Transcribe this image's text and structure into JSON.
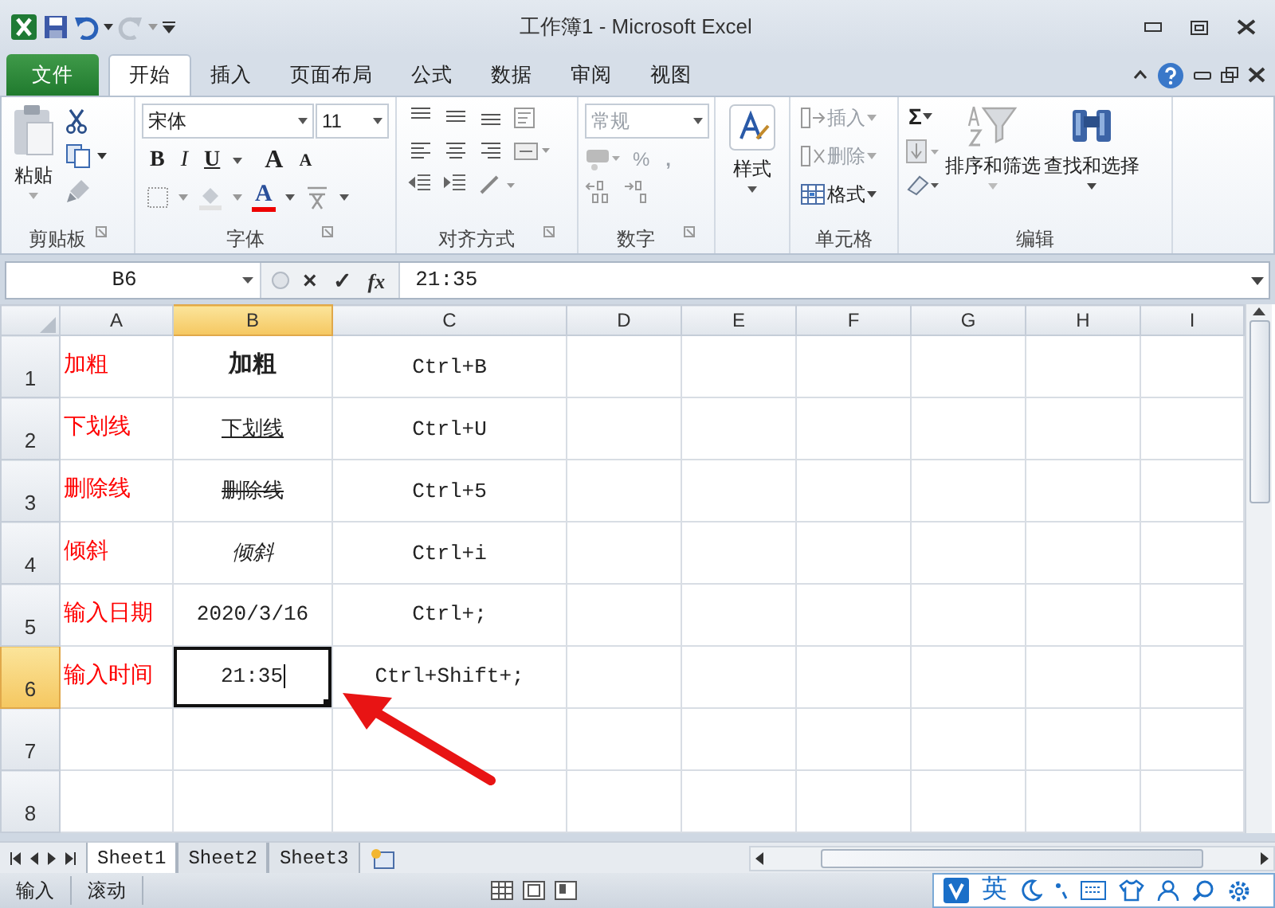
{
  "window": {
    "title": "工作簿1 - Microsoft Excel"
  },
  "tabs": [
    {
      "label": "文件",
      "kind": "file",
      "selected": false
    },
    {
      "label": "开始",
      "kind": "tab",
      "selected": true
    },
    {
      "label": "插入",
      "kind": "tab",
      "selected": false
    },
    {
      "label": "页面布局",
      "kind": "tab",
      "selected": false
    },
    {
      "label": "公式",
      "kind": "tab",
      "selected": false
    },
    {
      "label": "数据",
      "kind": "tab",
      "selected": false
    },
    {
      "label": "审阅",
      "kind": "tab",
      "selected": false
    },
    {
      "label": "视图",
      "kind": "tab",
      "selected": false
    }
  ],
  "ribbon": {
    "clipboard": {
      "label": "剪贴板",
      "paste": "粘贴"
    },
    "font": {
      "label": "字体",
      "font_name": "宋体",
      "font_size": "11",
      "bold": "B",
      "italic": "I",
      "underline": "U",
      "grow": "A",
      "shrink": "A",
      "font_color_button": "A"
    },
    "alignment": {
      "label": "对齐方式"
    },
    "number": {
      "label": "数字",
      "format": "常规",
      "percent": "%",
      "comma": ","
    },
    "styles": {
      "button": "样式"
    },
    "cells": {
      "label": "单元格",
      "buttons": [
        {
          "label": "插入",
          "disabled": true
        },
        {
          "label": "删除",
          "disabled": true
        },
        {
          "label": "格式",
          "disabled": false
        }
      ]
    },
    "editing": {
      "label": "编辑",
      "sum": "Σ",
      "buttons": [
        {
          "label": "排序和筛选",
          "disabled": true
        },
        {
          "label": "查找和选择",
          "disabled": false
        }
      ]
    }
  },
  "formula_bar": {
    "name_box": "B6",
    "cancel": "×",
    "enter": "✓",
    "fx": "fx",
    "value": "21:35"
  },
  "columns": [
    {
      "label": "A",
      "selected": false
    },
    {
      "label": "B",
      "selected": true
    },
    {
      "label": "C",
      "selected": false
    },
    {
      "label": "D",
      "selected": false
    },
    {
      "label": "E",
      "selected": false
    },
    {
      "label": "F",
      "selected": false
    },
    {
      "label": "G",
      "selected": false
    },
    {
      "label": "H",
      "selected": false
    },
    {
      "label": "I",
      "selected": false
    }
  ],
  "rows": [
    {
      "header": "1",
      "selected": false,
      "cells": [
        {
          "text": "加粗",
          "kind": "plain",
          "selected": false
        },
        {
          "text": "加粗",
          "kind": "bold",
          "selected": false
        },
        {
          "text": "Ctrl+B",
          "kind": "plain",
          "selected": false
        }
      ]
    },
    {
      "header": "2",
      "selected": false,
      "cells": [
        {
          "text": "下划线",
          "kind": "plain",
          "selected": false
        },
        {
          "text": "下划线",
          "kind": "underline",
          "selected": false
        },
        {
          "text": "Ctrl+U",
          "kind": "plain",
          "selected": false
        }
      ]
    },
    {
      "header": "3",
      "selected": false,
      "cells": [
        {
          "text": "删除线",
          "kind": "plain",
          "selected": false
        },
        {
          "text": "删除线",
          "kind": "strike",
          "selected": false
        },
        {
          "text": "Ctrl+5",
          "kind": "plain",
          "selected": false
        }
      ]
    },
    {
      "header": "4",
      "selected": false,
      "cells": [
        {
          "text": "倾斜",
          "kind": "plain",
          "selected": false
        },
        {
          "text": "倾斜",
          "kind": "italic",
          "selected": false
        },
        {
          "text": "Ctrl+i",
          "kind": "plain",
          "selected": false
        }
      ]
    },
    {
      "header": "5",
      "selected": false,
      "cells": [
        {
          "text": "输入日期",
          "kind": "plain",
          "selected": false
        },
        {
          "text": "2020/3/16",
          "kind": "plain",
          "selected": false
        },
        {
          "text": "Ctrl+;",
          "kind": "plain",
          "selected": false
        }
      ]
    },
    {
      "header": "6",
      "selected": true,
      "cells": [
        {
          "text": "输入时间",
          "kind": "plain",
          "selected": false
        },
        {
          "text": "21:35",
          "kind": "plain",
          "selected": true
        },
        {
          "text": "Ctrl+Shift+;",
          "kind": "plain",
          "selected": false
        }
      ]
    },
    {
      "header": "7",
      "selected": false
    },
    {
      "header": "8",
      "selected": false
    }
  ],
  "sheets": [
    {
      "label": "Sheet1",
      "selected": true
    },
    {
      "label": "Sheet2",
      "selected": false
    },
    {
      "label": "Sheet3",
      "selected": false
    }
  ],
  "status_bar": {
    "mode": "输入",
    "scroll": "滚动"
  },
  "ime_bar": {
    "language": "英"
  }
}
